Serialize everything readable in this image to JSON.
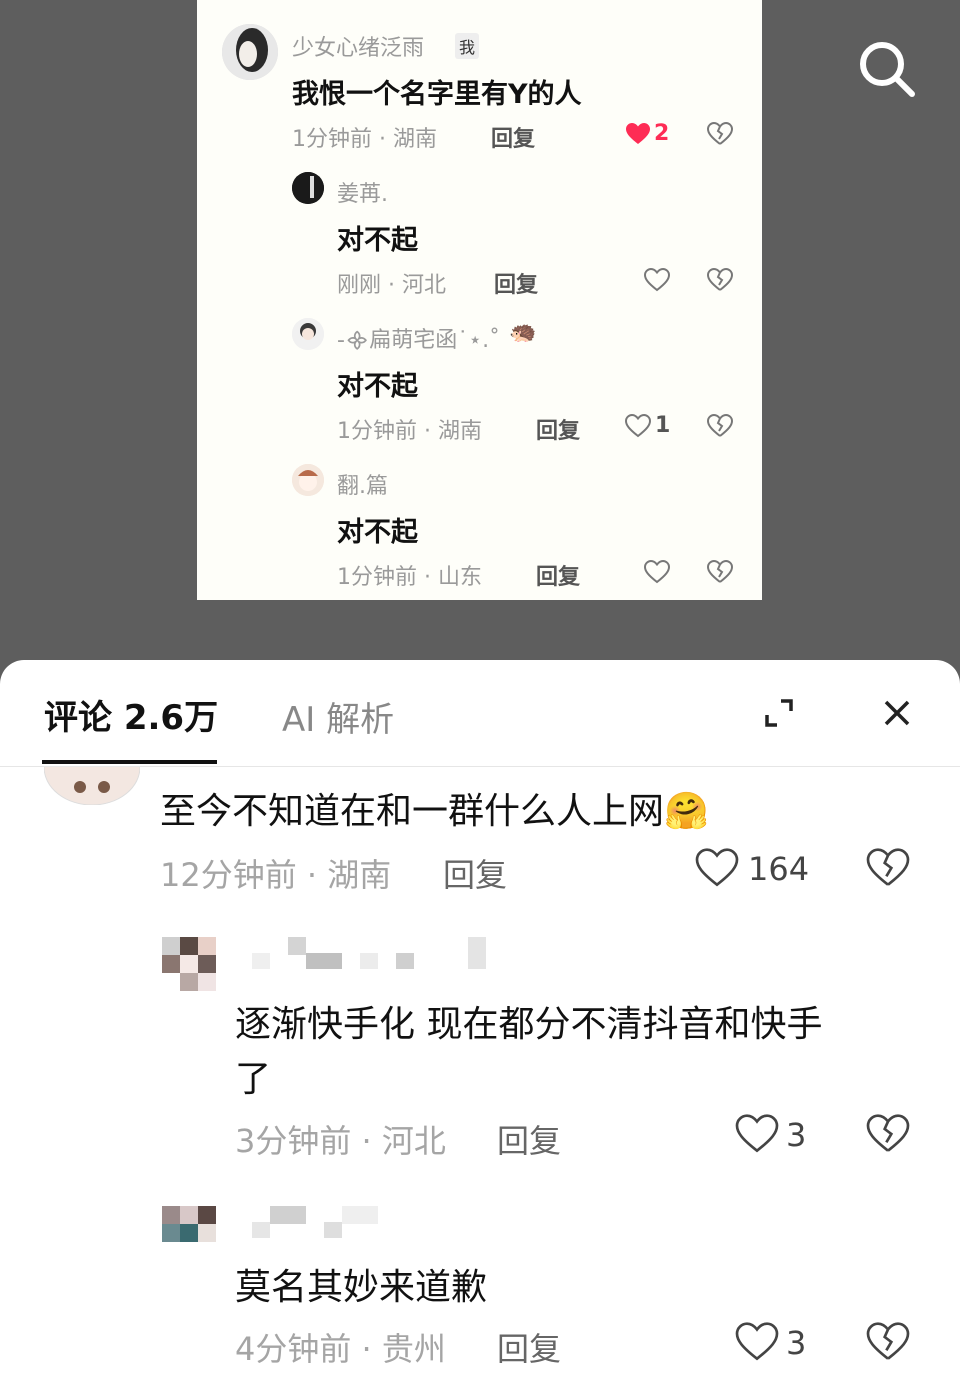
{
  "card": {
    "main": {
      "username": "少女心绪泛雨",
      "me_tag": "我",
      "text": "我恨一个名字里有Y的人",
      "time": "1分钟前",
      "location": "湖南",
      "reply_label": "回复",
      "like_count": "2"
    },
    "replies": [
      {
        "username": "姜苒.",
        "text": "对不起",
        "time": "刚刚",
        "location": "河北",
        "reply_label": "回复",
        "like_count": ""
      },
      {
        "username": "-᯽扁萌宅函˙⋆.˚",
        "text": "对不起",
        "time": "1分钟前",
        "location": "湖南",
        "reply_label": "回复",
        "like_count": "1"
      },
      {
        "username": "翻.篇",
        "text": "对不起",
        "time": "1分钟前",
        "location": "山东",
        "reply_label": "回复",
        "like_count": ""
      }
    ]
  },
  "sheet": {
    "tab_comments": "评论 2.6万",
    "tab_ai": "AI 解析"
  },
  "comments": [
    {
      "text": "至今不知道在和一群什么人上网",
      "emoji": "🤗",
      "time": "12分钟前",
      "location": "湖南",
      "reply_label": "回复",
      "like_count": "164"
    },
    {
      "text_line1": "逐渐快手化 现在都分不清抖音和快手",
      "text_line2": "了",
      "time": "3分钟前",
      "location": "河北",
      "reply_label": "回复",
      "like_count": "3"
    },
    {
      "text": "莫名其妙来道歉",
      "time": "4分钟前",
      "location": "贵州",
      "reply_label": "回复",
      "like_count": "3"
    }
  ],
  "separator": " · ",
  "colors": {
    "sheet_bg": "#ffffff",
    "video_bg": "#5e5e5e",
    "like_red": "#fe2c55",
    "muted_text": "#a5a5a5"
  },
  "icons": [
    "search-icon",
    "heart-icon",
    "dislike-icon",
    "expand-icon",
    "close-icon"
  ]
}
